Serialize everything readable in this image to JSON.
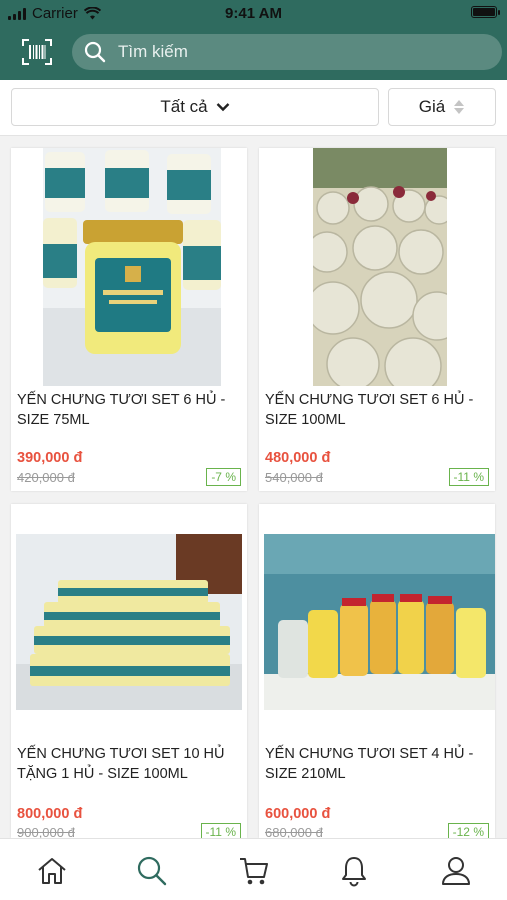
{
  "status_bar": {
    "carrier": "Carrier",
    "time": "9:41 AM"
  },
  "search": {
    "placeholder": "Tìm kiếm"
  },
  "filters": {
    "all_label": "Tất cả",
    "price_label": "Giá"
  },
  "colors": {
    "header": "#2f6b5f",
    "price": "#e8523f",
    "discount": "#69b34c"
  },
  "products": [
    {
      "name": "YẾN CHƯNG TƯƠI SET 6 HỦ - SIZE 75ML",
      "price": "390,000 đ",
      "old_price": "420,000 đ",
      "discount": "-7 %"
    },
    {
      "name": "YẾN CHƯNG TƯƠI SET 6 HỦ - SIZE 100ML",
      "price": "480,000 đ",
      "old_price": "540,000 đ",
      "discount": "-11 %"
    },
    {
      "name": "YẾN CHƯNG TƯƠI SET 10 HỦ TẶNG 1 HỦ - SIZE 100ML",
      "price": "800,000 đ",
      "old_price": "900,000 đ",
      "discount": "-11 %"
    },
    {
      "name": "YẾN CHƯNG TƯƠI SET 4 HỦ - SIZE 210ML",
      "price": "600,000 đ",
      "old_price": "680,000 đ",
      "discount": "-12 %"
    }
  ],
  "bottom_nav": [
    {
      "icon": "home-icon"
    },
    {
      "icon": "search-icon",
      "active": true
    },
    {
      "icon": "cart-icon"
    },
    {
      "icon": "bell-icon"
    },
    {
      "icon": "user-icon"
    }
  ]
}
